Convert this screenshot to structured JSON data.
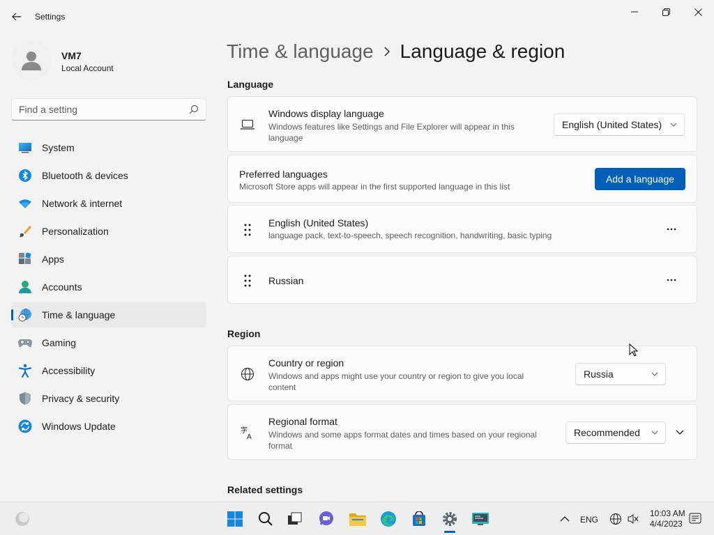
{
  "window": {
    "title": "Settings"
  },
  "profile": {
    "name": "VM7",
    "account_type": "Local Account"
  },
  "search": {
    "placeholder": "Find a setting"
  },
  "sidebar": {
    "items": [
      {
        "label": "System"
      },
      {
        "label": "Bluetooth & devices"
      },
      {
        "label": "Network & internet"
      },
      {
        "label": "Personalization"
      },
      {
        "label": "Apps"
      },
      {
        "label": "Accounts"
      },
      {
        "label": "Time & language"
      },
      {
        "label": "Gaming"
      },
      {
        "label": "Accessibility"
      },
      {
        "label": "Privacy & security"
      },
      {
        "label": "Windows Update"
      }
    ]
  },
  "breadcrumb": {
    "parent": "Time & language",
    "current": "Language & region"
  },
  "language": {
    "section_title": "Language",
    "display": {
      "title": "Windows display language",
      "desc_line1": "Windows features like Settings and File Explorer will appear in this",
      "desc_line2": "language",
      "value": "English (United States)"
    },
    "preferred": {
      "title": "Preferred languages",
      "desc": "Microsoft Store apps will appear in the first supported language in this list",
      "add_button": "Add a language"
    },
    "list": [
      {
        "name": "English (United States)",
        "features": "language pack, text-to-speech, speech recognition, handwriting, basic typing"
      },
      {
        "name": "Russian",
        "features": ""
      }
    ]
  },
  "region": {
    "section_title": "Region",
    "country": {
      "title": "Country or region",
      "desc_line1": "Windows and apps might use your country or region to give you local",
      "desc_line2": "content",
      "value": "Russia"
    },
    "format": {
      "title": "Regional format",
      "desc_line1": "Windows and some apps format dates and times based on your regional",
      "desc_line2": "format",
      "value": "Recommended"
    }
  },
  "related": {
    "section_title": "Related settings"
  },
  "taskbar": {
    "language": "ENG",
    "time": "10:03 AM",
    "date": "4/4/2023"
  },
  "colors": {
    "accent": "#005fb8"
  }
}
